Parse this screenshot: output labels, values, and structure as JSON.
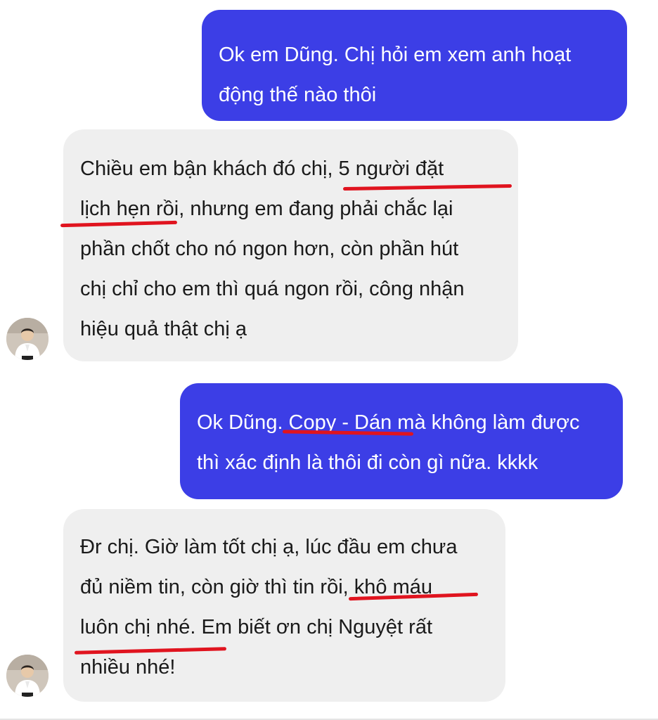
{
  "colors": {
    "outgoing_bubble": "#3c3ee6",
    "incoming_bubble": "#efefef",
    "underline_marker": "#e0141f"
  },
  "messages": [
    {
      "direction": "outgoing",
      "lines": [
        "Ok em Dũng. Chị hỏi em xem anh hoạt",
        "động thế nào thôi"
      ]
    },
    {
      "direction": "incoming",
      "lines": [
        "Chiều em bận khách đó chị, 5 người đặt",
        "lịch hẹn rồi, nhưng em đang phải chắc lại",
        "phần chốt cho nó ngon hơn, còn phần hút",
        "chị chỉ cho em thì quá ngon rồi, công nhận",
        "hiệu quả thật chị ạ"
      ]
    },
    {
      "direction": "outgoing",
      "lines": [
        "Ok Dũng. Copy - Dán mà không làm được",
        "thì xác định là thôi đi còn gì nữa. kkkk"
      ]
    },
    {
      "direction": "incoming",
      "lines": [
        "Đr chị. Giờ làm tốt chị ạ, lúc đầu em chưa",
        "đủ niềm tin, còn giờ thì tin rồi, khô máu",
        "luôn chị nhé. Em biết ơn chị Nguyệt rất",
        "nhiều nhé!"
      ]
    }
  ],
  "avatar_icon": "user-photo-avatar",
  "underline_icon": "red-marker-underline"
}
